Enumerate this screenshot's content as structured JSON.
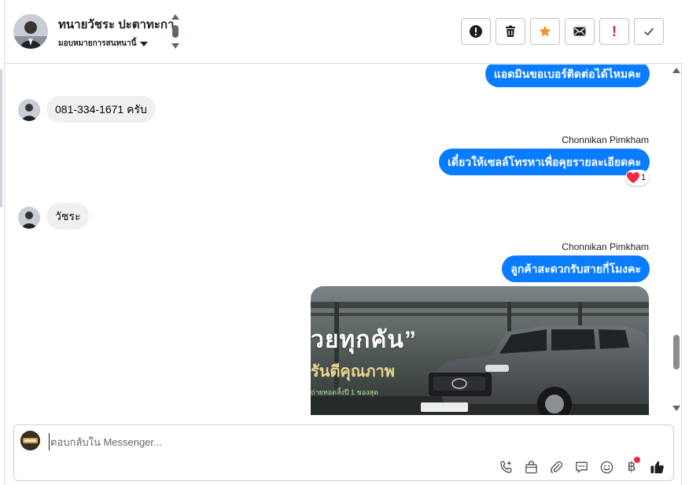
{
  "header": {
    "contact_name": "ทนายวัชระ ปะตาทะกา",
    "assign_label": "มอบหมายการสนทนานี้",
    "actions": [
      {
        "name": "spam-button",
        "icon": "alert-circle-icon"
      },
      {
        "name": "delete-button",
        "icon": "trash-icon"
      },
      {
        "name": "star-button",
        "icon": "star-icon"
      },
      {
        "name": "mark-unread-button",
        "icon": "envelope-icon"
      },
      {
        "name": "important-button",
        "icon": "exclamation-icon",
        "text": "!"
      },
      {
        "name": "mark-done-button",
        "icon": "check-icon"
      }
    ]
  },
  "messages": {
    "m1": {
      "direction": "outgoing",
      "text": "แอดมินขอเบอร์ติดต่อได้ไหมคะ"
    },
    "m2": {
      "direction": "incoming",
      "text": "081-334-1671 ครับ"
    },
    "m3": {
      "direction": "outgoing",
      "sender": "Chonnikan Pimkham",
      "text": "เดี๋ยวให้เซลล์โทรหาเพื่อคุยรายละเอียดคะ",
      "reaction": {
        "emoji": "heart-icon",
        "count": "1"
      }
    },
    "m4": {
      "direction": "incoming",
      "text": "วัชระ"
    },
    "m5": {
      "direction": "outgoing",
      "sender": "Chonnikan Pimkham",
      "text": "ลูกค้าสะดวกรับสายกี่โมงคะ"
    },
    "m6": {
      "direction": "outgoing",
      "type": "image",
      "caption1": "วยทุกคัน”",
      "caption2": "รันตีคุณภาพ",
      "caption3": "ิถ่ายทอดสิ้งปี 1  ของสุด"
    }
  },
  "composer": {
    "placeholder": "ตอบกลับใน Messenger...",
    "tools": [
      "phone-plus-icon",
      "shopping-bag-icon",
      "paperclip-icon",
      "chat-bubble-icon",
      "smiley-icon",
      "baht-icon",
      "thumbs-up-icon"
    ],
    "baht_symbol": "฿"
  },
  "colors": {
    "accent": "#0a7cff",
    "incoming_bubble": "#f0f0f0",
    "star": "#f5922a",
    "danger": "#e41e3f"
  }
}
